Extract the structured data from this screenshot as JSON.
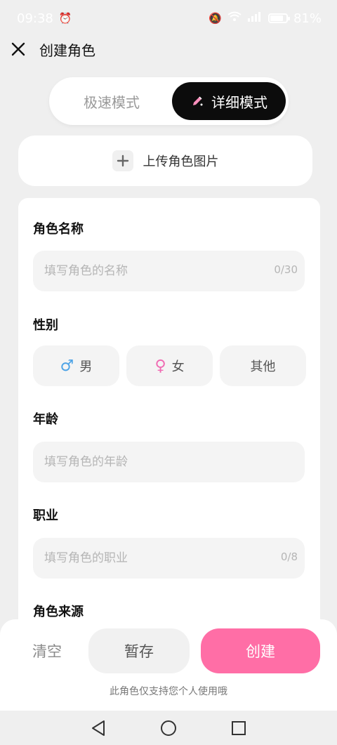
{
  "status": {
    "time": "09:38",
    "battery": "81%",
    "battery_level": 0.81,
    "signal_label": "4G"
  },
  "header": {
    "title": "创建角色"
  },
  "mode_switch": {
    "fast_label": "极速模式",
    "detail_label": "详细模式"
  },
  "upload": {
    "label": "上传角色图片"
  },
  "form": {
    "name_label": "角色名称",
    "name_placeholder": "填写角色的名称",
    "name_counter": "0/30",
    "gender_label": "性别",
    "gender_options": {
      "male": "男",
      "female": "女",
      "other": "其他"
    },
    "age_label": "年龄",
    "age_placeholder": "填写角色的年龄",
    "job_label": "职业",
    "job_placeholder": "填写角色的职业",
    "job_counter": "0/8",
    "source_label": "角色来源"
  },
  "actions": {
    "clear": "清空",
    "save": "暂存",
    "create": "创建",
    "notice": "此角色仅支持您个人使用哦"
  },
  "colors": {
    "accent": "#ff6ea6",
    "male": "#4da3e6",
    "female": "#f06bb3"
  }
}
